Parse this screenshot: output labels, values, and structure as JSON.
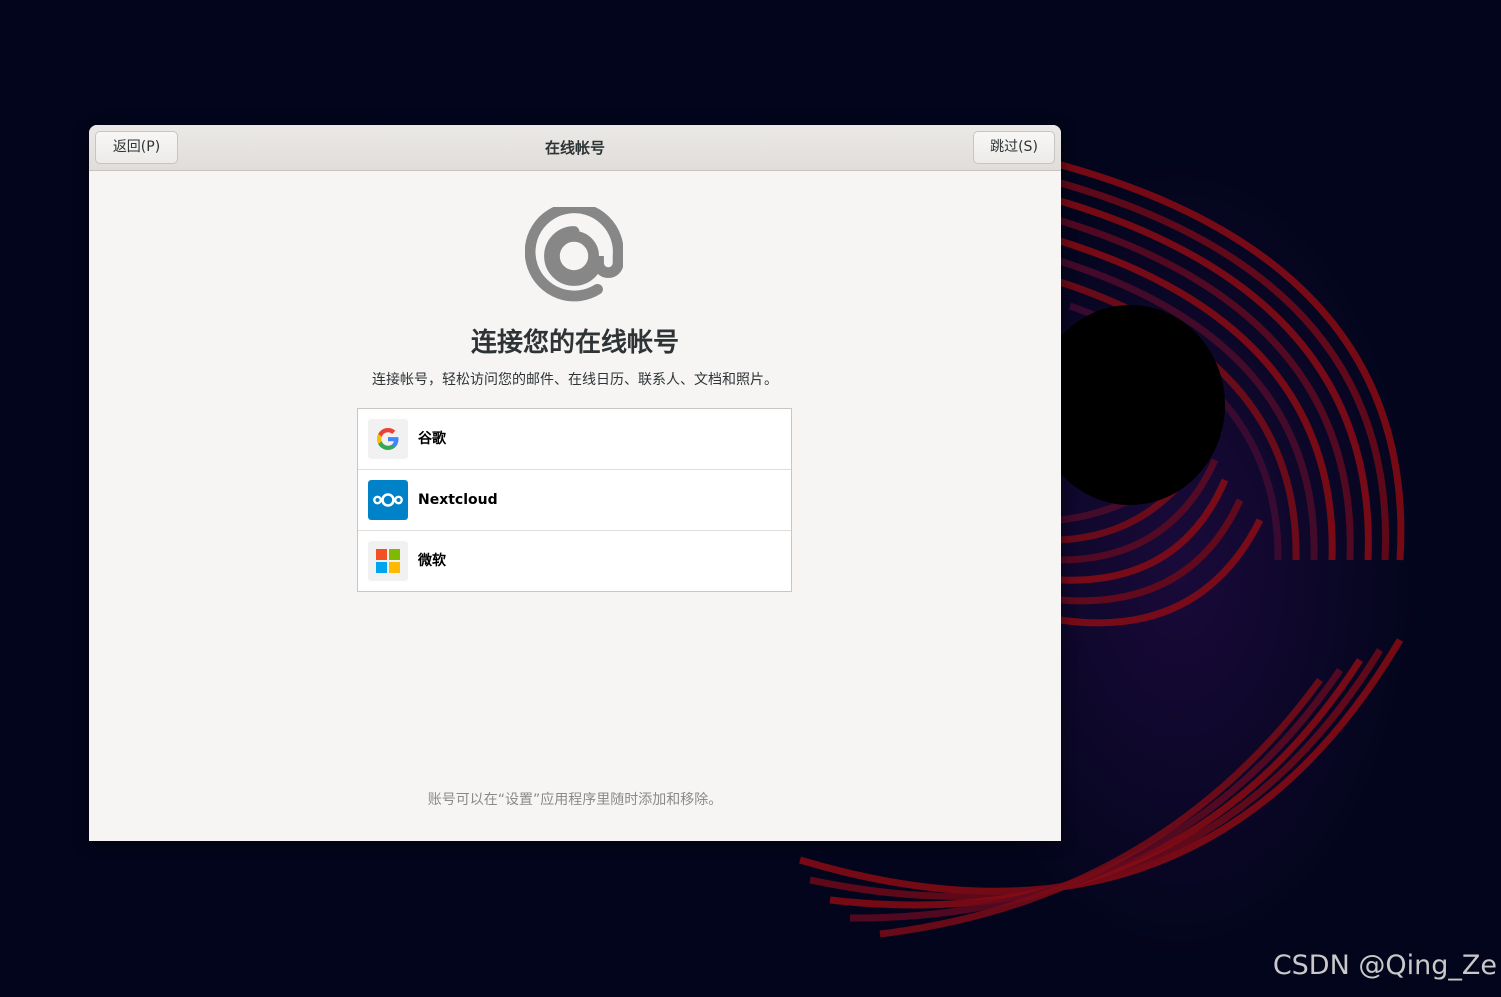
{
  "window": {
    "title": "在线帐号",
    "back_label": "返回(P)",
    "skip_label": "跳过(S)"
  },
  "main": {
    "icon": "at-sign-icon",
    "heading": "连接您的在线帐号",
    "subtitle": "连接帐号，轻松访问您的邮件、在线日历、联系人、文档和照片。",
    "providers": [
      {
        "label": "谷歌",
        "icon": "google-icon"
      },
      {
        "label": "Nextcloud",
        "icon": "nextcloud-icon"
      },
      {
        "label": "微软",
        "icon": "microsoft-icon"
      }
    ],
    "footer": "账号可以在“设置”应用程序里随时添加和移除。"
  },
  "watermark": "CSDN @Qing_Ze",
  "colors": {
    "desktop_bg": "#03051c",
    "window_bg": "#f6f5f4",
    "nextcloud_blue": "#0082c9",
    "icon_gray": "#878787"
  }
}
